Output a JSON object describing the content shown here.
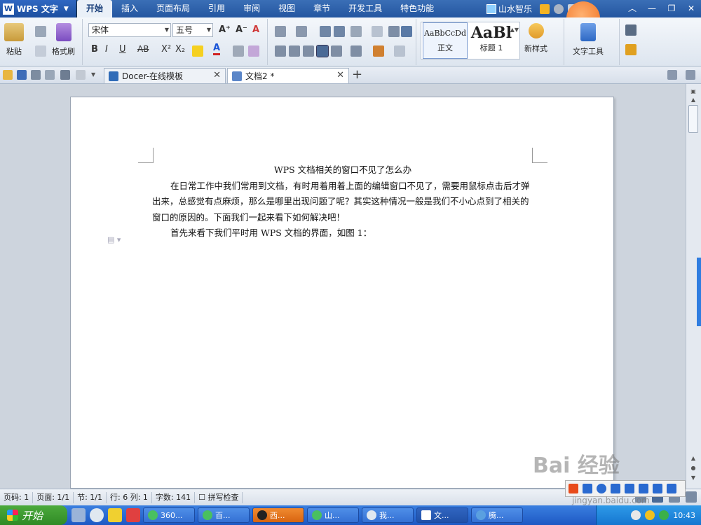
{
  "menubar": {
    "app_name": "WPS 文字",
    "tabs": [
      "开始",
      "插入",
      "页面布局",
      "引用",
      "审阅",
      "视图",
      "章节",
      "开发工具",
      "特色功能"
    ],
    "user_name": "山水智乐"
  },
  "ribbon": {
    "paste_label": "粘贴",
    "format_painter_label": "格式刷",
    "font_name": "宋体",
    "font_size": "五号",
    "style_normal_sample": "AaBbCcDd",
    "style_normal_label": "正文",
    "style_heading_sample": "AaBl",
    "style_heading_label": "标题 1",
    "new_style_label": "新样式",
    "text_tool_label": "文字工具"
  },
  "tabs": {
    "docer": "Docer-在线模板",
    "doc2": "文档2 *"
  },
  "document": {
    "title": "WPS 文档相关的窗口不见了怎么办",
    "para1": "在日常工作中我们常用到文档，有时用着用着上面的编辑窗口不见了，需要用鼠标点击后才弹出来，总感觉有点麻烦，那么是哪里出现问题了呢？其实这种情况一般是我们不小心点到了相关的窗口的原因的。下面我们一起来看下如何解决吧！",
    "para2": "首先来看下我们平时用 WPS 文档的界面，如图 1："
  },
  "status": {
    "page_code": "页码: 1",
    "page": "页面: 1/1",
    "section": "节: 1/1",
    "row_col": "行: 6  列: 1",
    "word_count": "字数: 141",
    "spell_check": "拼写检查"
  },
  "taskbar": {
    "start": "开始",
    "tasks": [
      "360...",
      "百...",
      "西...",
      "山...",
      "我...",
      "文...",
      "腾..."
    ],
    "clock": "10:43"
  },
  "watermark": {
    "brand": "Bai 经验",
    "url": "jingyan.baidu.com"
  }
}
